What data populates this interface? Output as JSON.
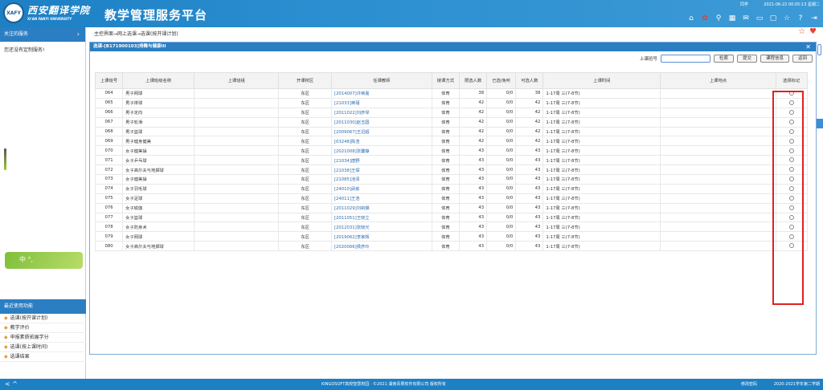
{
  "header": {
    "logo_text": "XAFY",
    "school_name": "西安翻译学院",
    "school_en": "XI'AN FANYI UNIVERSITY",
    "title": "教学管理服务平台",
    "user": "同学",
    "datetime": "2021-06-22 00:05:13 星期二"
  },
  "leftpanel": {
    "head": "关注的服务",
    "empty_msg": "您还没有定制服务!",
    "ime_text": "中 °,",
    "box_title": "最近使用功能",
    "items": [
      "选课(按开课计划)",
      "教学评价",
      "申报素质拓展学分",
      "选课(按上课时间)",
      "选课结果"
    ]
  },
  "breadcrumb": "主控界面→网上选课→选课(按开课计划)",
  "dialog": {
    "title": "选课-[B171900103]排舞与健康III",
    "search_label": "上课班号",
    "search_value": "",
    "buttons": {
      "search": "检索",
      "submit": "提交",
      "info": "课程信息",
      "back": "返回"
    }
  },
  "table": {
    "headers": [
      "上课班号",
      "上课班级名称",
      "上课班组",
      "开课校区",
      "任课教师",
      "授课方式",
      "限选人数",
      "已选/免听",
      "可选人数",
      "上课时间",
      "上课地点",
      "选择标记"
    ],
    "rows": [
      [
        "064",
        "男子网球",
        "",
        "东区",
        "[2014007]许荣嘉",
        "体育",
        "38",
        "0/0",
        "38",
        "1-17周 三(7-8节)",
        ""
      ],
      [
        "065",
        "男子排球",
        "",
        "东区",
        "[21033]蒋瑾",
        "体育",
        "42",
        "0/0",
        "42",
        "1-17周 三(7-8节)",
        ""
      ],
      [
        "066",
        "男子定向",
        "",
        "东区",
        "[2011022]刘彦琴",
        "体育",
        "42",
        "0/0",
        "42",
        "1-17周 三(7-8节)",
        ""
      ],
      [
        "067",
        "男子轮滑",
        "",
        "东区",
        "[2011030]赵玉圆",
        "体育",
        "42",
        "0/0",
        "42",
        "1-17周 三(7-8节)",
        ""
      ],
      [
        "068",
        "男子篮球",
        "",
        "东区",
        "[2009067]王迅超",
        "体育",
        "42",
        "0/0",
        "42",
        "1-17周 三(7-8节)",
        ""
      ],
      [
        "069",
        "男子健身健美",
        "",
        "东区",
        "[03248]陈浩",
        "体育",
        "42",
        "0/0",
        "42",
        "1-17周 三(7-8节)",
        ""
      ],
      [
        "070",
        "女子健美操",
        "",
        "东区",
        "[2021008]张馨静",
        "体育",
        "43",
        "0/0",
        "43",
        "1-17周 三(7-8节)",
        ""
      ],
      [
        "071",
        "女子乒乓球",
        "",
        "东区",
        "[21034]唐野",
        "体育",
        "43",
        "0/0",
        "43",
        "1-17周 三(7-8节)",
        ""
      ],
      [
        "072",
        "女子高尔夫与地掷球",
        "",
        "东区",
        "[21038]王琛",
        "体育",
        "43",
        "0/0",
        "43",
        "1-17周 三(7-8节)",
        ""
      ],
      [
        "073",
        "女子健美操",
        "",
        "东区",
        "[21085]池泽",
        "体育",
        "43",
        "0/0",
        "43",
        "1-17周 三(7-8节)",
        ""
      ],
      [
        "074",
        "女子羽毛球",
        "",
        "东区",
        "[24010]武栋",
        "体育",
        "43",
        "0/0",
        "43",
        "1-17周 三(7-8节)",
        ""
      ],
      [
        "075",
        "女子足球",
        "",
        "东区",
        "[24011]王浩",
        "体育",
        "43",
        "0/0",
        "43",
        "1-17周 三(7-8节)",
        ""
      ],
      [
        "076",
        "女子瑜伽",
        "",
        "东区",
        "[2011029]刘莉娜",
        "体育",
        "43",
        "0/0",
        "43",
        "1-17周 三(7-8节)",
        ""
      ],
      [
        "077",
        "女子篮球",
        "",
        "东区",
        "[2011051]王晓立",
        "体育",
        "43",
        "0/0",
        "43",
        "1-17周 三(7-8节)",
        ""
      ],
      [
        "078",
        "女子防身术",
        "",
        "东区",
        "[2012031]张晓光",
        "体育",
        "43",
        "0/0",
        "43",
        "1-17周 三(7-8节)",
        ""
      ],
      [
        "079",
        "女子网球",
        "",
        "东区",
        "[2019062]李家辉",
        "体育",
        "43",
        "0/0",
        "43",
        "1-17周 三(7-8节)",
        ""
      ],
      [
        "080",
        "女子高尔夫与地掷球",
        "",
        "东区",
        "[2020066]侯彦玲",
        "体育",
        "43",
        "0/0",
        "43",
        "1-17周 三(7-8节)",
        ""
      ]
    ]
  },
  "footer": {
    "nav": "< ^",
    "copyright": "KINGOSOFT高校智慧校园 · ©2021 湖南青果软件有限公司 版权所有",
    "change_pwd": "修改密码",
    "term": "2020-2021学年第二学期"
  }
}
